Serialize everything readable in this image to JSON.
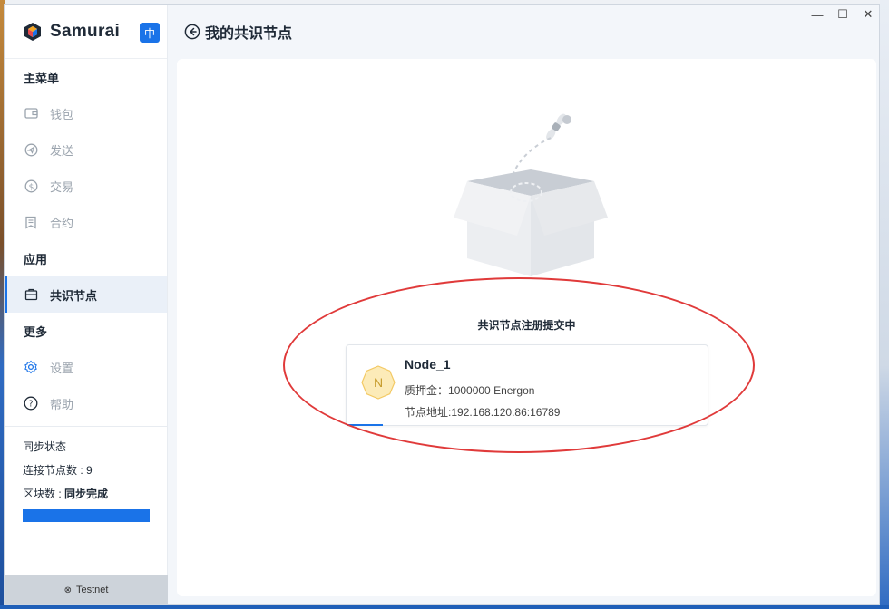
{
  "app": {
    "brand": "Samurai",
    "lang_button": "中"
  },
  "sidebar": {
    "sections": [
      {
        "title": "主菜单"
      },
      {
        "title": "应用"
      },
      {
        "title": "更多"
      }
    ],
    "items": [
      {
        "label": "钱包",
        "icon": "wallet-icon"
      },
      {
        "label": "发送",
        "icon": "send-icon"
      },
      {
        "label": "交易",
        "icon": "dollar-icon"
      },
      {
        "label": "合约",
        "icon": "contract-icon"
      },
      {
        "label": "共识节点",
        "icon": "node-icon",
        "active": true
      },
      {
        "label": "设置",
        "icon": "gear-icon"
      },
      {
        "label": "帮助",
        "icon": "help-icon"
      }
    ],
    "status": {
      "title": "同步状态",
      "peers_label": "连接节点数 : ",
      "peers_value": "9",
      "blocks_label": "区块数 : ",
      "blocks_value": "同步完成",
      "progress": 1.0
    },
    "network": "Testnet"
  },
  "header": {
    "title": "我的共识节点"
  },
  "main": {
    "registration_title": "共识节点注册提交中",
    "node": {
      "avatar_letter": "N",
      "name": "Node_1",
      "stake_label": "质押金：",
      "stake_value": "1000000 Energon",
      "address_label": "节点地址:",
      "address_value": "192.168.120.86:16789"
    }
  },
  "colors": {
    "accent": "#1a73e8",
    "annotation": "#e03a3a",
    "avatar_fill": "#fcebb8"
  }
}
